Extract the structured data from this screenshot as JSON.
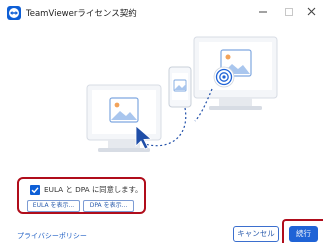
{
  "window": {
    "title": "TeamViewerライセンス契約",
    "icons": {
      "app": "teamviewer-logo-icon",
      "minimize": "minimize-icon",
      "maximize": "maximize-icon",
      "close": "close-icon"
    }
  },
  "illustration": {
    "icons": [
      "monitor-icon",
      "smartphone-icon",
      "image-icon",
      "target-icon",
      "mouse-cursor-icon"
    ]
  },
  "consent": {
    "checked": true,
    "label": "EULA と DPA に同意します。",
    "eula_button": "EULA を表示...",
    "dpa_button": "DPA を表示..."
  },
  "footer": {
    "privacy_link": "プライバシーポリシー",
    "cancel_button": "キャンセル",
    "continue_button": "続行"
  },
  "colors": {
    "accent": "#1f63d6",
    "highlight_frame": "#b00d1b",
    "link": "#1f5fc4"
  }
}
